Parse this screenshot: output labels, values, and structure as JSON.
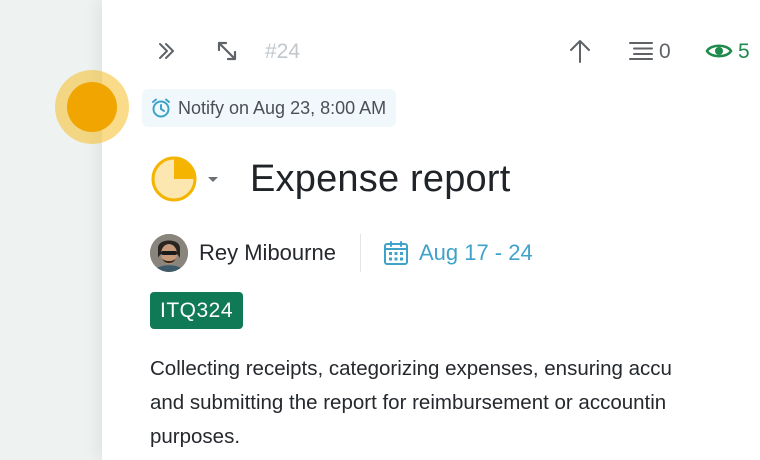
{
  "toolbar": {
    "task_id": "#24",
    "subtasks_count": "0",
    "watchers_count": "5",
    "icons": [
      "expand-right-icon",
      "resize-icon",
      "arrow-up-icon",
      "list-icon",
      "eye-icon"
    ]
  },
  "reminder": {
    "text": "Notify on Aug 23, 8:00 AM",
    "icon": "alarm-clock-icon"
  },
  "task": {
    "title": "Expense report",
    "progress_fraction": 0.25,
    "assignee": "Rey Mibourne",
    "date_range": "Aug 17 - 24",
    "tag": "ITQ324",
    "description_lines": [
      "Collecting receipts, categorizing expenses, ensuring accu",
      "and submitting the report for reimbursement or accountin",
      "purposes."
    ]
  },
  "colors": {
    "accent_green": "#0f7a55",
    "date_blue": "#3fa3c9",
    "progress_yellow": "#fcd36b",
    "eye_green": "#1e8a4b"
  }
}
